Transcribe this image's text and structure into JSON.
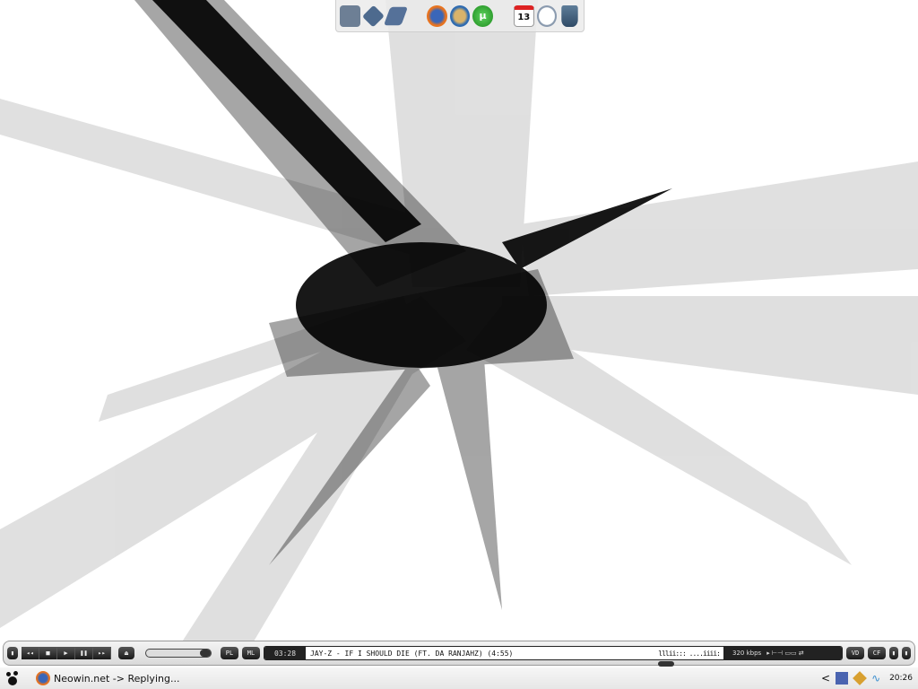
{
  "dock": {
    "items": [
      {
        "name": "my-computer",
        "label": ""
      },
      {
        "name": "drive",
        "label": ""
      },
      {
        "name": "drive2",
        "label": ""
      },
      {
        "name": "firefox",
        "label": ""
      },
      {
        "name": "thunderbird",
        "label": ""
      },
      {
        "name": "utorrent",
        "label": "µ"
      },
      {
        "name": "calendar",
        "label": "13"
      },
      {
        "name": "clock",
        "label": ""
      },
      {
        "name": "recycle-bin",
        "label": ""
      }
    ]
  },
  "player": {
    "buttons": {
      "prev": "◂◂",
      "stop": "■",
      "play": "▶",
      "pause": "❚❚",
      "next": "▸▸",
      "eject": "⏏",
      "pl": "PL",
      "ml": "ML",
      "vd": "VD",
      "cf": "CF"
    },
    "time": "03:28",
    "track": "JAY-Z - IF I SHOULD DIE (FT. DA RANJAHZ) (4:55)",
    "visualizer": "lllii:::  ....iiii:",
    "bitrate": "320 kbps",
    "seek_fraction": 0.95,
    "track_progress": 0.7
  },
  "taskbar": {
    "task": "Neowin.net -> Replying...",
    "clock": "20:26",
    "tray_arrow": "<"
  }
}
